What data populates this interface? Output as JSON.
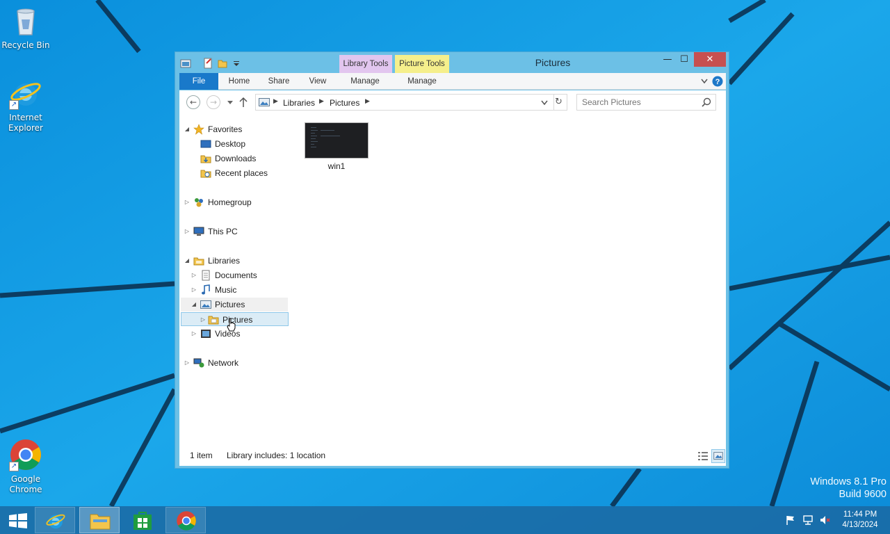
{
  "desktop": {
    "icons": [
      {
        "label": "Recycle Bin",
        "icon": "recycle-bin-icon"
      },
      {
        "label": "Internet Explorer",
        "icon": "internet-explorer-icon"
      },
      {
        "label": "Google Chrome",
        "icon": "google-chrome-icon"
      }
    ],
    "watermark": {
      "line1": "Windows 8.1 Pro",
      "line2": "Build 9600"
    }
  },
  "window": {
    "title": "Pictures",
    "context_tabs": [
      {
        "label": "Library Tools",
        "color": "#e2c6ef"
      },
      {
        "label": "Picture Tools",
        "color": "#f5ef8c"
      }
    ],
    "ribbon_tabs": [
      "File",
      "Home",
      "Share",
      "View",
      "Manage",
      "Manage"
    ],
    "address": {
      "crumbs": [
        "Libraries",
        "Pictures"
      ]
    },
    "search": {
      "placeholder": "Search Pictures"
    },
    "nav_tree": {
      "favorites": "Favorites",
      "desktop": "Desktop",
      "downloads": "Downloads",
      "recent": "Recent places",
      "homegroup": "Homegroup",
      "thispc": "This PC",
      "libraries": "Libraries",
      "documents": "Documents",
      "music": "Music",
      "pictures": "Pictures",
      "pictures_child": "Pictures",
      "videos": "Videos",
      "network": "Network"
    },
    "files": [
      {
        "name": "win1",
        "type": "image-thumbnail"
      }
    ],
    "status": {
      "count": "1 item",
      "library": "Library includes: 1 location"
    }
  },
  "taskbar": {
    "items": [
      "start-button",
      "internet-explorer",
      "file-explorer",
      "windows-store",
      "google-chrome"
    ],
    "clock": {
      "time": "11:44 PM",
      "date": "4/13/2024"
    }
  },
  "colors": {
    "wallpaper": "#1aa3e8",
    "window_frame": "#6cc0e6",
    "file_tab": "#1979ca",
    "close_button": "#c75050",
    "selection": "#dbecf6"
  }
}
